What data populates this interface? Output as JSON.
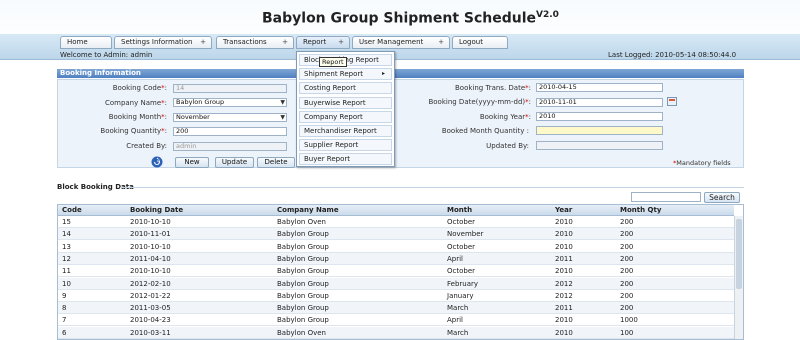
{
  "app": {
    "title": "Babylon Group Shipment Schedule",
    "version": "V2.0"
  },
  "nav": {
    "tabs": [
      {
        "label": "Home",
        "plus": ""
      },
      {
        "label": "Settings Information",
        "plus": "+"
      },
      {
        "label": "Transactions",
        "plus": "+"
      },
      {
        "label": "Report",
        "plus": "+"
      },
      {
        "label": "User Management",
        "plus": "+"
      },
      {
        "label": "Logout",
        "plus": ""
      }
    ]
  },
  "welcome": "Welcome to Admin: admin",
  "last_logged": "Last Logged: 2010-05-14 08:50:44.0",
  "booking_info": {
    "section_title": "Booking Information",
    "booking_code_label": "Booking Code",
    "booking_code_value": "14",
    "company_name_label": "Company Name",
    "company_name_value": "Babylon Group",
    "booking_month_label": "Booking Month",
    "booking_month_value": "November",
    "booking_quantity_label": "Booking Quantity",
    "booking_quantity_value": "200",
    "created_by_label": "Created By:",
    "created_by_value": "admin",
    "trans_date_label": "Booking Trans. Date",
    "trans_date_value": "2010-04-15",
    "booking_date_label": "Booking Date(yyyy-mm-dd)",
    "booking_date_value": "2010-11-01",
    "booking_year_label": "Booking Year",
    "booking_year_value": "2010",
    "booked_month_qty_label": "Booked Month Quantity :",
    "updated_by_label": "Updated By:",
    "req_mark": "*",
    "colon": ":",
    "btn_new": "New",
    "btn_update": "Update",
    "btn_delete": "Delete",
    "mandatory_mark": "*",
    "mandatory_text": "Mandatory fields"
  },
  "report_menu": {
    "items": [
      {
        "label": "Block Booking Report",
        "arrow": ""
      },
      {
        "label": "Shipment Report",
        "arrow": "▸"
      },
      {
        "label": "Costing Report",
        "arrow": ""
      },
      {
        "label": "Buyerwise Report",
        "arrow": ""
      },
      {
        "label": "Company Report",
        "arrow": ""
      },
      {
        "label": "Merchandiser Report",
        "arrow": ""
      },
      {
        "label": "Supplier Report",
        "arrow": ""
      },
      {
        "label": "Buyer Report",
        "arrow": ""
      }
    ],
    "tooltip": "Report"
  },
  "grid": {
    "title": "Block Booking Data",
    "search_label": "Search",
    "columns": [
      "Code",
      "Booking Date",
      "Company Name",
      "Month",
      "Year",
      "Month Qty"
    ],
    "rows": [
      [
        "15",
        "2010-10-10",
        "Babylon Oven",
        "October",
        "2010",
        "200"
      ],
      [
        "14",
        "2010-11-01",
        "Babylon Group",
        "November",
        "2010",
        "200"
      ],
      [
        "13",
        "2010-10-10",
        "Babylon Group",
        "October",
        "2010",
        "200"
      ],
      [
        "12",
        "2011-04-10",
        "Babylon Group",
        "April",
        "2011",
        "200"
      ],
      [
        "11",
        "2010-10-10",
        "Babylon Group",
        "October",
        "2010",
        "200"
      ],
      [
        "10",
        "2012-02-10",
        "Babylon Group",
        "February",
        "2012",
        "200"
      ],
      [
        "9",
        "2012-01-22",
        "Babylon Group",
        "January",
        "2012",
        "200"
      ],
      [
        "8",
        "2011-03-05",
        "Babylon Group",
        "March",
        "2011",
        "200"
      ],
      [
        "7",
        "2010-04-23",
        "Babylon Group",
        "April",
        "2010",
        "1000"
      ],
      [
        "6",
        "2010-03-11",
        "Babylon Oven",
        "March",
        "2010",
        "100"
      ]
    ]
  }
}
